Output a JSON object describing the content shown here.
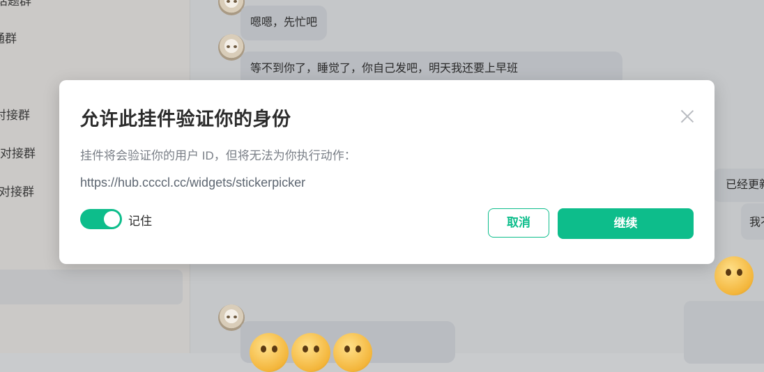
{
  "sidebar": {
    "items": [
      {
        "label": "话题群"
      },
      {
        "label": "通群"
      },
      {
        "label": "对接群"
      },
      {
        "label": "对接群"
      },
      {
        "label": "对接群"
      }
    ]
  },
  "chat": {
    "messages": [
      {
        "text": "嗯嗯，先忙吧"
      },
      {
        "text": "等不到你了，睡觉了，你自己发吧，明天我还要上早班"
      }
    ],
    "right_messages": [
      {
        "text": "已经更新"
      },
      {
        "text": "我不"
      }
    ]
  },
  "dialog": {
    "title": "允许此挂件验证你的身份",
    "description": "挂件将会验证你的用户 ID，但将无法为你执行动作：",
    "url": "https://hub.ccccl.cc/widgets/stickerpicker",
    "remember_label": "记住",
    "remember_on": true,
    "cancel_label": "取消",
    "continue_label": "继续",
    "accent_color": "#0dbd8b"
  }
}
